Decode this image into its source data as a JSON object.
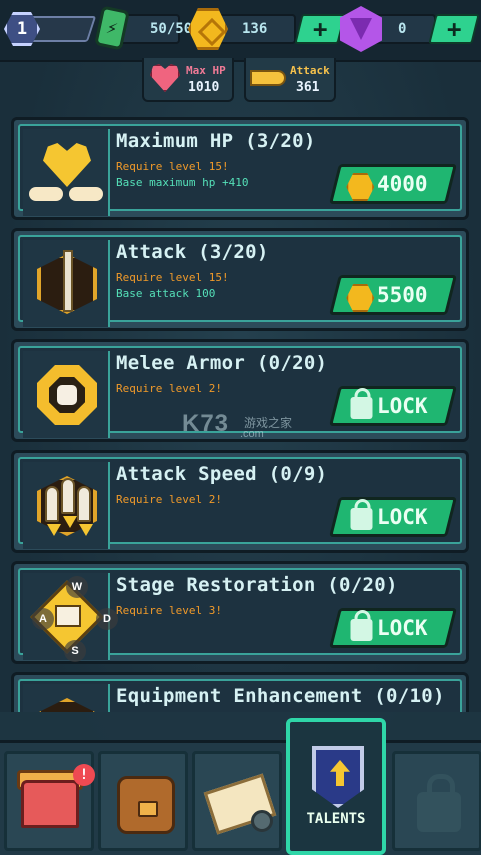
{
  "topbar": {
    "level": "1",
    "energy": "50/50",
    "coins": "136",
    "gems": "0",
    "plus_label": "+"
  },
  "stats": {
    "hp_label": "Max HP",
    "hp_value": "1010",
    "attack_label": "Attack",
    "attack_value": "361"
  },
  "talents": [
    {
      "title": "Maximum HP (3/20)",
      "requirement": "Require level 15!",
      "base": "Base maximum hp +410",
      "button": "4000",
      "button_type": "cost",
      "icon": "gold-heart-wings-icon"
    },
    {
      "title": "Attack (3/20)",
      "requirement": "Require level 15!",
      "base": "Base attack 100",
      "button": "5500",
      "button_type": "cost",
      "icon": "sword-icon"
    },
    {
      "title": "Melee Armor (0/20)",
      "requirement": "Require level 2!",
      "base": "",
      "button": "LOCK",
      "button_type": "lock",
      "icon": "fist-shield-icon"
    },
    {
      "title": "Attack Speed (0/9)",
      "requirement": "Require level 2!",
      "base": "",
      "button": "LOCK",
      "button_type": "lock",
      "icon": "rockets-icon"
    },
    {
      "title": "Stage Restoration (0/20)",
      "requirement": "Require level 3!",
      "base": "",
      "button": "LOCK",
      "button_type": "lock",
      "icon": "book-icon"
    },
    {
      "title": "Equipment Enhancement (0/10)",
      "requirement": "",
      "base": "",
      "button": "",
      "button_type": "none",
      "icon": "medal-icon"
    }
  ],
  "overlay_keys": {
    "w": "W",
    "a": "A",
    "s": "S",
    "d": "D"
  },
  "watermark": {
    "main": "K73",
    "sub": "游戏之家",
    "url": ".com"
  },
  "nav": {
    "badge": "!",
    "talents_label": "TALENTS"
  },
  "colors": {
    "accent_green": "#1fb671",
    "gold": "#f3b81e",
    "requirement_orange": "#f09a2a",
    "base_teal": "#55e0b8"
  }
}
